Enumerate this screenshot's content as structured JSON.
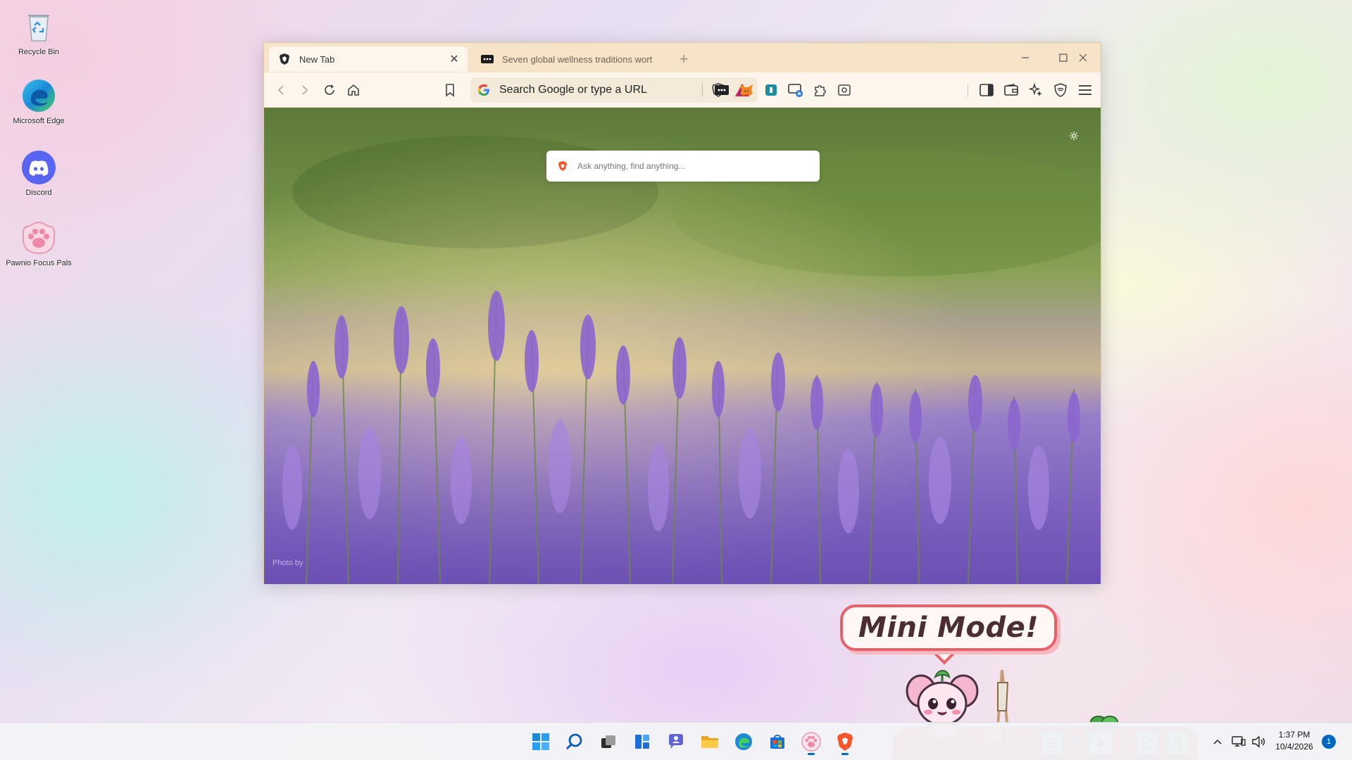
{
  "desktop": {
    "icons": [
      {
        "label": "Recycle Bin",
        "icon": "recycle-bin-icon"
      },
      {
        "label": "Microsoft Edge",
        "icon": "edge-icon"
      },
      {
        "label": "Discord",
        "icon": "discord-icon"
      },
      {
        "label": "Pawnio Focus Pals",
        "icon": "paw-icon"
      }
    ]
  },
  "browser": {
    "tabs": [
      {
        "title": "New Tab",
        "icon": "brave-icon",
        "active": true
      },
      {
        "title": "Seven global wellness traditions wort",
        "icon": "site-dots-icon",
        "active": false
      }
    ],
    "url_placeholder": "Search Google or type a URL",
    "extensions": [
      "dots-extension-icon",
      "metamask-fox-icon",
      "app-extension-icon",
      "screen-extension-icon",
      "puzzle-icon",
      "screenshot-icon"
    ],
    "toolbar_right": [
      "sidebar-icon",
      "wallet-icon",
      "leo-ai-icon",
      "vpn-icon",
      "menu-icon"
    ]
  },
  "newtab": {
    "search_placeholder": "Ask anything, find anything...",
    "photo_credit": "Photo by"
  },
  "widget": {
    "speech_text": "Mini Mode!"
  },
  "taskbar": {
    "apps": [
      "start-icon",
      "search-icon",
      "task-view-icon",
      "widgets-icon",
      "chat-icon",
      "file-explorer-icon",
      "edge-icon",
      "store-icon",
      "paw-icon",
      "brave-icon"
    ],
    "time": "1:37 PM",
    "date": "10/4/2026",
    "notifications": "1"
  },
  "colors": {
    "tabbar": "#f7e3c8",
    "toolbar": "#fdf6ec",
    "speech_border": "#e8606a",
    "pet_bar": "#e04e52",
    "accent": "#0067c0"
  }
}
